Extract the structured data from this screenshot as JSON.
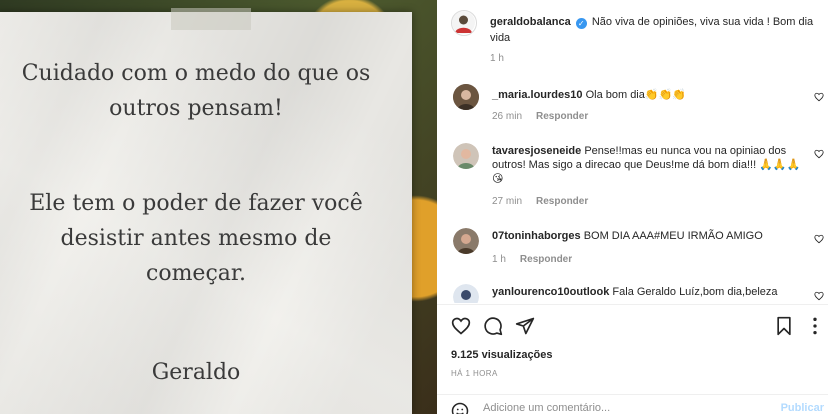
{
  "post_image": {
    "quote_line1": "Cuidado com o medo do que os",
    "quote_line2": "outros pensam!",
    "quote_line3": "Ele tem o poder de fazer você",
    "quote_line4": "desistir antes mesmo de",
    "quote_line5": "começar.",
    "signature": "Geraldo"
  },
  "caption": {
    "username": "geraldobalanca",
    "text_line1": "Não viva de opiniões, viva sua vida ! Bom dia",
    "text_line2": "vida",
    "age": "1 h"
  },
  "comments": [
    {
      "username": "_maria.lourdes10",
      "text": "Ola bom dia",
      "emoji": "👏👏👏",
      "age": "26 min",
      "reply": "Responder"
    },
    {
      "username": "tavaresjoseneide",
      "text_line1": "Pense!!mas eu nunca vou na opiniao dos",
      "text_line2": "outros! Mas sigo a direcao que Deus!me dá bom dia!!!",
      "emoji_line2": "🙏🙏🙏",
      "emoji_line3": "😘",
      "age": "27 min",
      "reply": "Responder"
    },
    {
      "username": "07toninhaborges",
      "text": "BOM DIA AAA#MEU IRMÃO AMIGO",
      "age": "1 h",
      "reply": "Responder"
    },
    {
      "username": "yanlourenco10outlook",
      "text": "Fala Geraldo Luíz,bom dia,beleza"
    }
  ],
  "engagement": {
    "views": "9.125 visualizações",
    "posted": "HÁ 1 HORA"
  },
  "comment_box": {
    "placeholder": "Adicione um comentário...",
    "publish": "Publicar"
  },
  "colors": {
    "verified": "#3897f0",
    "secondary_text": "#8e8e8e",
    "publish_disabled": "#b3dbff"
  }
}
